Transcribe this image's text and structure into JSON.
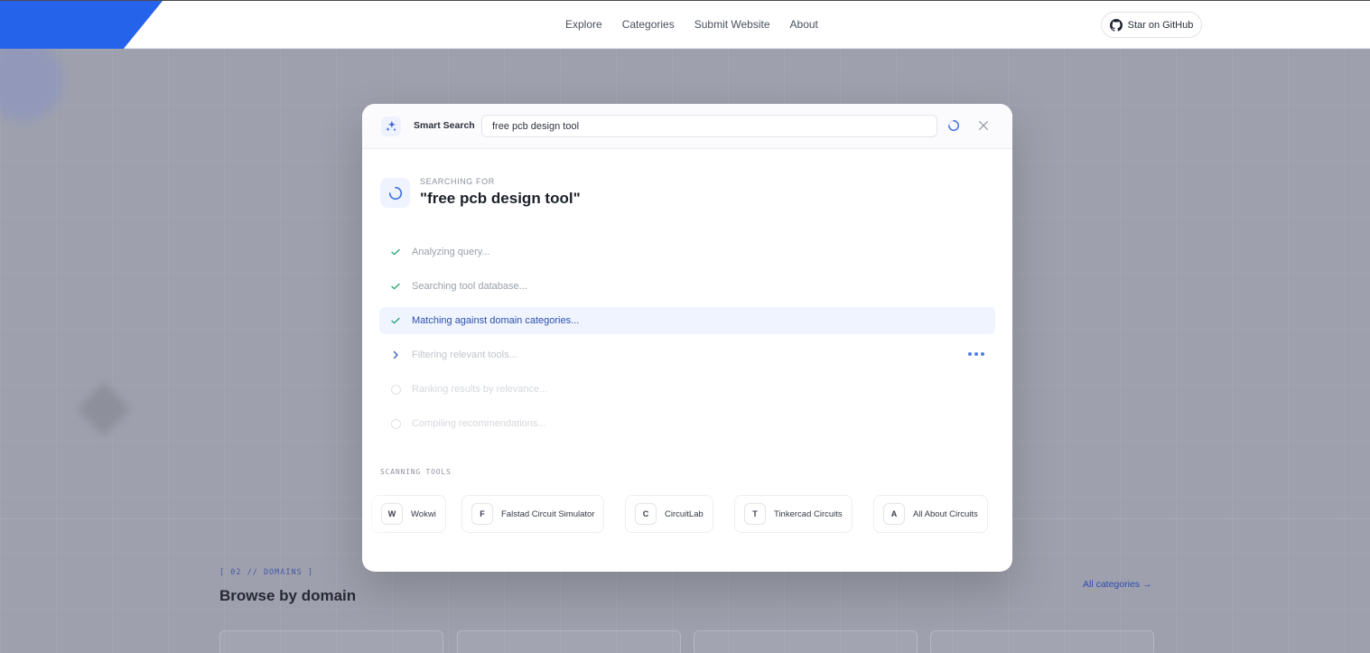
{
  "nav": {
    "links": [
      "Explore",
      "Categories",
      "Submit Website",
      "About"
    ],
    "github_label": "Star on GitHub"
  },
  "background": {
    "section_label": "[ 02 // DOMAINS ]",
    "section_title": "Browse by domain",
    "all_link": "All categories →"
  },
  "modal": {
    "title": "Smart Search",
    "search_value": "free pcb design tool",
    "searching_label": "SEARCHING FOR",
    "searching_query": "\"free pcb design tool\"",
    "steps": [
      {
        "label": "Analyzing query...",
        "status": "done"
      },
      {
        "label": "Searching tool database...",
        "status": "done"
      },
      {
        "label": "Matching against domain categories...",
        "status": "active"
      },
      {
        "label": "Filtering relevant tools...",
        "status": "in-progress"
      },
      {
        "label": "Ranking results by relevance...",
        "status": "pending"
      },
      {
        "label": "Compiling recommendations...",
        "status": "pending"
      }
    ],
    "scanning_label": "SCANNING TOOLS",
    "tools": [
      {
        "letter": "W",
        "name": "Wokwi"
      },
      {
        "letter": "F",
        "name": "Falstad Circuit Simulator"
      },
      {
        "letter": "C",
        "name": "CircuitLab"
      },
      {
        "letter": "T",
        "name": "Tinkercad Circuits"
      },
      {
        "letter": "A",
        "name": "All About Circuits"
      }
    ]
  },
  "colors": {
    "accent": "#2563eb",
    "check": "#22a06b",
    "active_bg": "#eff4ff",
    "overlay": "#9ea1ad"
  }
}
